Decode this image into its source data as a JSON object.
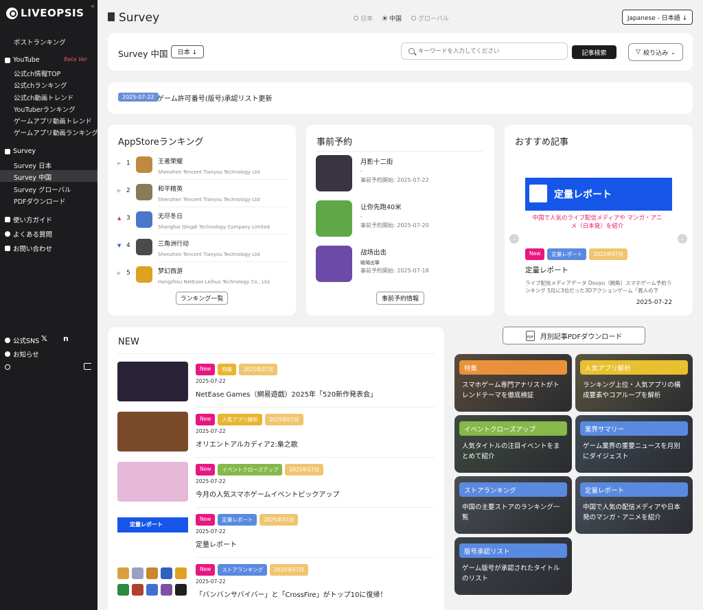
{
  "sidebar": {
    "logo": "LIVEOPSIS",
    "collapse_icon": "«",
    "items": {
      "post_ranking": "ポストランキング",
      "youtube": "YouTube",
      "beta": "Beta Ver",
      "yt_official_top": "公式ch情報TOP",
      "yt_official_rank": "公式chランキング",
      "yt_official_trend": "公式ch動画トレンド",
      "yt_youtuber_rank": "YouTuberランキング",
      "yt_game_trend": "ゲームアプリ動画トレンド",
      "yt_game_rank": "ゲームアプリ動画ランキング",
      "survey": "Survey",
      "survey_jp": "Survey 日本",
      "survey_cn": "Survey 中国",
      "survey_global": "Survey グローバル",
      "pdf_download": "PDFダウンロード",
      "guide": "使い方ガイド",
      "faq": "よくある質問",
      "contact": "お問い合わせ",
      "sns": "公式SNS",
      "sns_x": "𝕏",
      "sns_n": "n",
      "notice": "お知らせ"
    }
  },
  "topbar": {
    "title": "Survey",
    "regions": [
      "日本",
      "中国",
      "グローバル"
    ],
    "selected_region": "中国",
    "language": "Japanese - 日本語 ↓"
  },
  "filter_panel": {
    "title": "Survey 中国",
    "country_select": "日本 ↓",
    "search_placeholder": "キーワードを入力してください",
    "search_button": "記事検索",
    "filter_button": "絞り込み"
  },
  "notice_bar": {
    "date": "2025-07-22",
    "text": "ゲーム許可番号(版号)承認リスト更新"
  },
  "appstore": {
    "title": "AppStoreランキング",
    "rows": [
      {
        "rank": "1",
        "name": "王者荣耀",
        "company": "Shenzhen Tencent Tianyou Technology Ltd",
        "trend": "▶",
        "color": "#c08a3e"
      },
      {
        "rank": "2",
        "name": "和平精英",
        "company": "Shenzhen Tencent Tianyou Technology Ltd",
        "trend": "▶",
        "color": "#8a7b5a"
      },
      {
        "rank": "3",
        "name": "无尽冬日",
        "company": "Shanghai Qingdi Technology Company Limited",
        "trend": "▲",
        "color": "#4a78c8"
      },
      {
        "rank": "4",
        "name": "三角洲行动",
        "company": "Shenzhen Tencent Tianyou Technology Ltd",
        "trend": "▼",
        "color": "#4b4b4b"
      },
      {
        "rank": "5",
        "name": "梦幻西游",
        "company": "Hangzhou NetEase Leihuo Technology Co., Ltd.",
        "trend": "▶",
        "color": "#e0a020"
      }
    ],
    "button": "ランキング一覧"
  },
  "preregister": {
    "title": "事前予約",
    "rows": [
      {
        "name": "月影十二街",
        "sub": "-",
        "date": "事前予約開始: 2025-07-22",
        "color": "#3a3340"
      },
      {
        "name": "让你先跑40米",
        "sub": "-",
        "date": "事前予約開始: 2025-07-20",
        "color": "#5fa84a"
      },
      {
        "name": "战场出击",
        "sub": "戦場出撃",
        "date": "事前予約開始: 2025-07-18",
        "color": "#6b4aa8"
      }
    ],
    "button": "事前予約情報"
  },
  "recommend": {
    "title": "おすすめ記事",
    "banner_title": "定量レポート",
    "banner_caption": "中国で人気のライブ配信メディアや マンガ・アニメ（日本発）を紹介",
    "tags": [
      "New",
      "定量レポート",
      "2025年07月"
    ],
    "article_title": "定量レポート",
    "excerpt": "ライブ配信メディアデータ Douyu（闘魚）スマホゲーム予約ランキング 5月に3位だった3Dアクションゲーム「異人の下",
    "date": "2025-07-22",
    "prev": "‹",
    "next": "›"
  },
  "news": {
    "title": "NEW",
    "items": [
      {
        "tags": [
          "New",
          "特集",
          "2025年07月"
        ],
        "date": "2025-07-22",
        "title": "NetEase Games（網易遊戯）2025年「520新作発表会」",
        "thumb_color": "#2a2236",
        "cat_color": "#e8b52e"
      },
      {
        "tags": [
          "New",
          "人気アプリ解析",
          "2025年07月"
        ],
        "date": "2025-07-22",
        "title": "オリエントアルカディア2:梟之歌",
        "thumb_color": "#7a4a2a",
        "cat_color": "#e8b52e"
      },
      {
        "tags": [
          "New",
          "イベントクローズアップ",
          "2025年07月"
        ],
        "date": "2025-07-22",
        "title": "今月の人気スマホゲームイベントピックアップ",
        "thumb_color": "#e6b8d8",
        "cat_color": "#86b84a"
      },
      {
        "tags": [
          "New",
          "定量レポート",
          "2025年07月"
        ],
        "date": "2025-07-22",
        "title": "定量レポート",
        "thumb_color": "#ffffff",
        "cat_color": "#5a8ae0"
      },
      {
        "tags": [
          "New",
          "ストアランキング",
          "2025年07月"
        ],
        "date": "2025-07-22",
        "title": "「バンバンサバイバー」と「CrossFire」がトップ10に復帰！",
        "thumb_color": "#ffffff",
        "cat_color": "#5a8ae0"
      }
    ],
    "mini_banner_text": "定量レポート"
  },
  "pdf_button": "月別記事PDFダウンロード",
  "pdf_icon": "PDF",
  "categories": [
    {
      "label": "特集",
      "desc": "スマホゲーム専門アナリストがトレンドテーマを徹底検証",
      "color": "#e8913a",
      "bg": "#5a4a3c"
    },
    {
      "label": "人気アプリ解析",
      "desc": "ランキング上位・人気アプリの構成要素やコアループを解析",
      "color": "#e8c030",
      "bg": "#5b5540"
    },
    {
      "label": "イベントクローズアップ",
      "desc": "人気タイトルの注目イベントをまとめて紹介",
      "color": "#86b84a",
      "bg": "#3f4a40"
    },
    {
      "label": "業界サマリー",
      "desc": "ゲーム業界の重要ニュースを月別にダイジェスト",
      "color": "#5a8ae0",
      "bg": "#3e4a56"
    },
    {
      "label": "ストアランキング",
      "desc": "中国の主要ストアのランキング一覧",
      "color": "#5a8ae0",
      "bg": "#4a4e52"
    },
    {
      "label": "定量レポート",
      "desc": "中国で人気の配信メディアや日本発のマンガ・アニメを紹介",
      "color": "#5a8ae0",
      "bg": "#48505a"
    },
    {
      "label": "版号承認リスト",
      "desc": "ゲーム版号が承認されたタイトルのリスト",
      "color": "#5a8ae0",
      "bg": "#3c4148"
    }
  ]
}
